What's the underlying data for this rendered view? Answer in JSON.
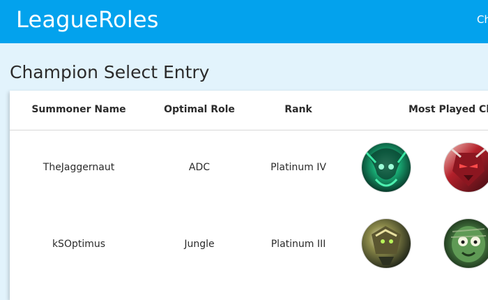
{
  "app": {
    "title": "LeagueRoles",
    "nav_link": "Ch"
  },
  "page": {
    "title": "Champion Select Entry"
  },
  "table": {
    "columns": [
      "Summoner Name",
      "Optimal Role",
      "Rank",
      "Most Played Ch"
    ],
    "rows": [
      {
        "summoner": "TheJaggernaut",
        "role": "ADC",
        "rank": "Platinum IV",
        "champions": [
          "champion-portrait-green-icon",
          "champion-portrait-red-masked-icon"
        ]
      },
      {
        "summoner": "kSOptimus",
        "role": "Jungle",
        "rank": "Platinum III",
        "champions": [
          "champion-portrait-gold-armored-icon",
          "champion-portrait-green-mummy-icon"
        ]
      }
    ]
  },
  "colors": {
    "appbar": "#03a2ed",
    "background": "#e2f3fc",
    "card": "#ffffff",
    "text": "#2b2b2b"
  }
}
